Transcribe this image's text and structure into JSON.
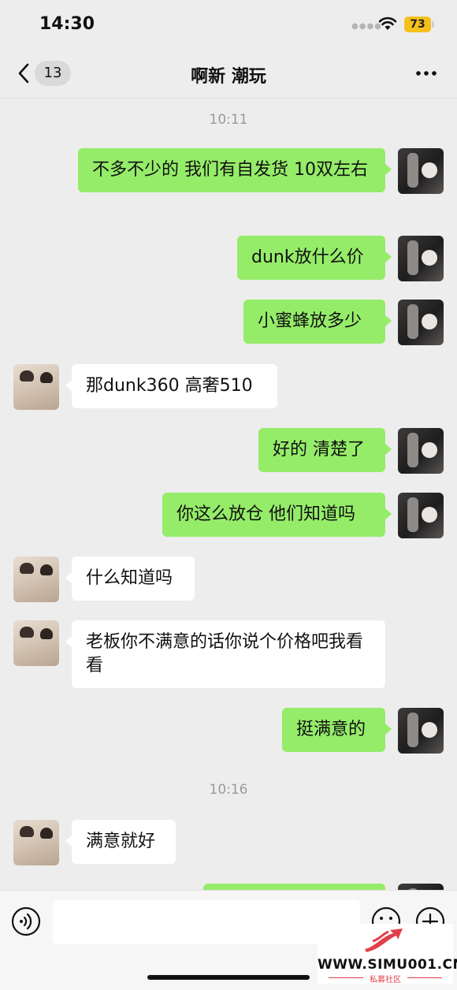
{
  "status_bar": {
    "time": "14:30",
    "battery": "73"
  },
  "nav": {
    "unread_count": "13",
    "title": "啊新 潮玩"
  },
  "messages": [
    {
      "type": "timestamp",
      "text": "10:11"
    },
    {
      "type": "msg",
      "side": "me",
      "text": "不多不少的 我们有自发货 10双左右"
    },
    {
      "type": "msg",
      "side": "me",
      "text": "dunk放什么价"
    },
    {
      "type": "msg",
      "side": "me",
      "text": "小蜜蜂放多少"
    },
    {
      "type": "msg",
      "side": "them",
      "text": "那dunk360  高奢510"
    },
    {
      "type": "msg",
      "side": "me",
      "text": "好的 清楚了"
    },
    {
      "type": "msg",
      "side": "me",
      "text": "你这么放仓 他们知道吗"
    },
    {
      "type": "msg",
      "side": "them",
      "text": "什么知道吗"
    },
    {
      "type": "msg",
      "side": "them",
      "text": "老板你不满意的话你说个价格吧我看看"
    },
    {
      "type": "msg",
      "side": "me",
      "text": "挺满意的"
    },
    {
      "type": "timestamp",
      "text": "10:16"
    },
    {
      "type": "msg",
      "side": "them",
      "text": "满意就好"
    }
  ],
  "input_bar": {
    "placeholder": ""
  },
  "watermark": {
    "url": "WWW.SIMU001.CN",
    "label": "私募社区"
  },
  "colors": {
    "my_bubble": "#95ec69",
    "their_bubble": "#ffffff",
    "background": "#ededed"
  },
  "icons": [
    "back-chevron-icon",
    "more-icon",
    "voice-icon",
    "emoji-icon",
    "plus-icon",
    "wifi-icon",
    "battery-icon"
  ]
}
